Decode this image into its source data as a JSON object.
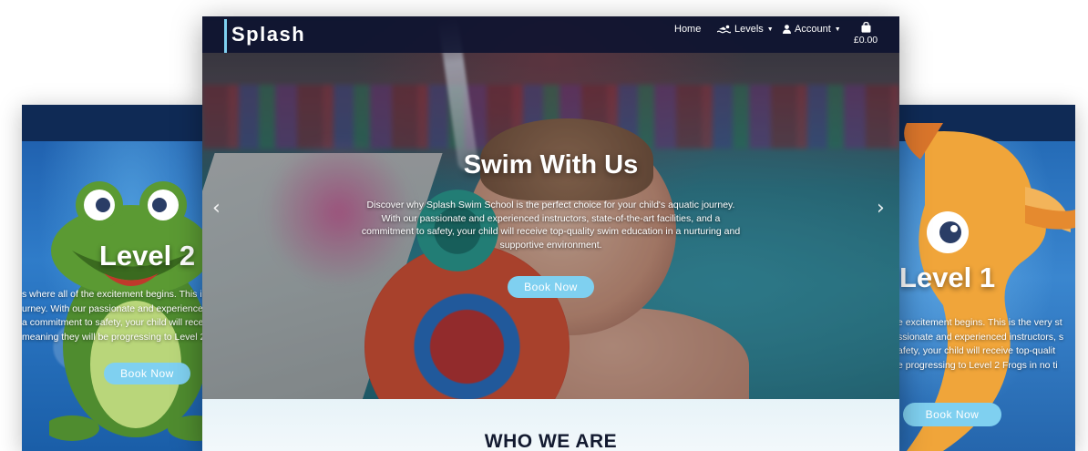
{
  "main": {
    "brand": "Splash",
    "nav": {
      "home": "Home",
      "levels": "Levels",
      "account": "Account",
      "cart_total": "£0.00"
    },
    "hero": {
      "title": "Swim With Us",
      "text": "Discover why Splash Swim School is the perfect choice for your child's aquatic journey. With our passionate and experienced instructors, state-of-the-art facilities, and a commitment to safety, your child will receive top-quality swim education in a nurturing and supportive environment.",
      "button": "Book Now",
      "prev_arrow": "‹",
      "next_arrow": "›"
    },
    "section_title": "WHO WE ARE"
  },
  "left_card": {
    "title": "Level 2",
    "text_lines": [
      "s where all of the excitement begins. This is",
      "urney. With our passionate and experienced",
      "a commitment to safety, your child will recei",
      "meaning they will be progressing to Level 2"
    ],
    "button": "Book Now"
  },
  "right_card": {
    "title": "Level 1",
    "text_lines": [
      "e excitement begins. This is the very st",
      "ssionate and experienced instructors, s",
      "afety, your child will receive top-qualit",
      "e progressing to Level 2 Frogs in no ti"
    ],
    "button": "Book Now"
  },
  "colors": {
    "accent": "#7fd0f0",
    "navbar": "#0c1230",
    "heading": "#131a30"
  },
  "icons": {
    "levels": "swimmer-icon",
    "account": "user-icon",
    "cart": "shopping-bag-icon"
  }
}
